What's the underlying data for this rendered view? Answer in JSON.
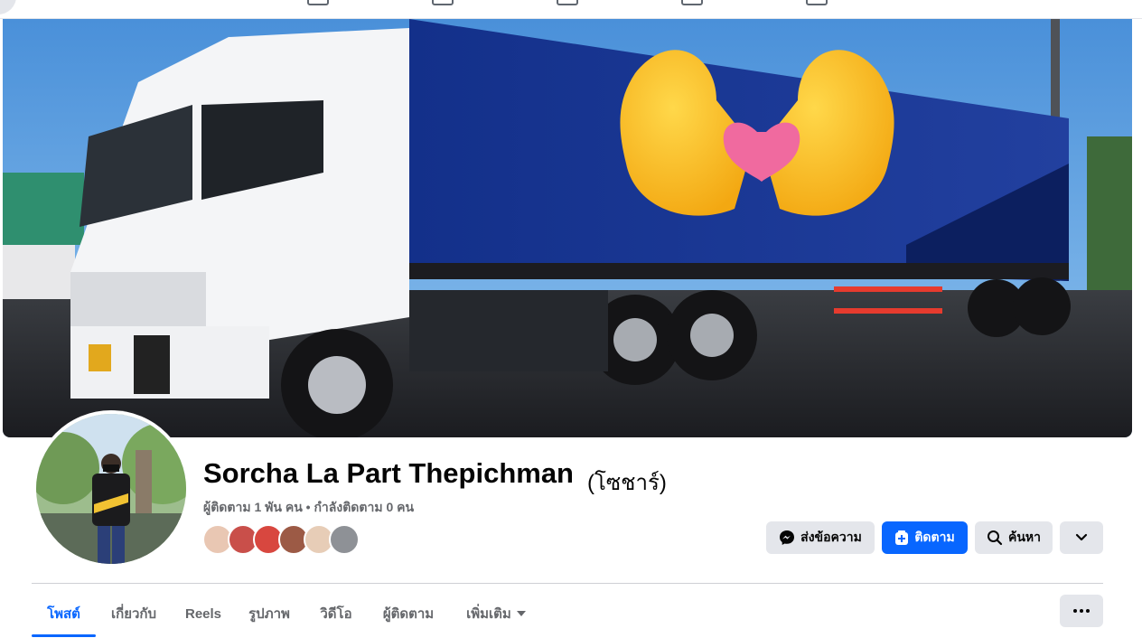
{
  "profile": {
    "name": "Sorcha La Part Thepichman",
    "alternate_name": "(โซชาร์)",
    "follow_stats": "ผู้ติดตาม 1 พัน คน • กำลังติดตาม 0 คน"
  },
  "actions": {
    "message_label": "ส่งข้อความ",
    "follow_label": "ติดตาม",
    "search_label": "ค้นหา"
  },
  "tabs": [
    {
      "label": "โพสต์",
      "active": true
    },
    {
      "label": "เกี่ยวกับ",
      "active": false
    },
    {
      "label": "Reels",
      "active": false
    },
    {
      "label": "รูปภาพ",
      "active": false
    },
    {
      "label": "วิดีโอ",
      "active": false
    },
    {
      "label": "ผู้ติดตาม",
      "active": false
    },
    {
      "label": "เพิ่มเติม",
      "active": false
    }
  ],
  "icons": {
    "messenger": "messenger-icon",
    "follow": "follow-icon",
    "search": "search-icon",
    "more": "chevron-down-icon",
    "menu": "ellipsis-icon"
  },
  "colors": {
    "accent": "#0866ff",
    "button_grey": "#e4e6eb",
    "text_primary": "#050505",
    "text_secondary": "#65676b"
  }
}
